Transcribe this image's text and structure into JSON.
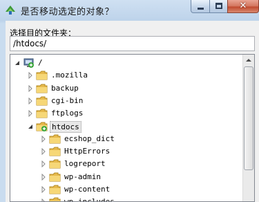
{
  "dialog": {
    "title": "是否移动选定的对象？",
    "close_glyph": "✕"
  },
  "destination": {
    "label": "选择目的文件夹：",
    "path_value": "/htdocs/"
  },
  "tree": {
    "items": [
      {
        "label": "/",
        "expanded": true
      },
      {
        "label": ".mozilla",
        "expanded": false
      },
      {
        "label": "backup",
        "expanded": false
      },
      {
        "label": "cgi-bin",
        "expanded": false
      },
      {
        "label": "ftplogs",
        "expanded": false
      },
      {
        "label": "htdocs",
        "expanded": true,
        "selected": true
      },
      {
        "label": "ecshop_dict",
        "expanded": false
      },
      {
        "label": "HttpErrors",
        "expanded": false
      },
      {
        "label": "logreport",
        "expanded": false
      },
      {
        "label": "wp-admin",
        "expanded": false
      },
      {
        "label": "wp-content",
        "expanded": false
      },
      {
        "label": "wp-includes",
        "expanded": false
      }
    ]
  },
  "icons": {
    "app": "recycle-arrow-icon",
    "root": "computer-icon",
    "folder": "folder-icon",
    "add_badge": "green-plus-badge-icon"
  },
  "colors": {
    "folder": "#e6b94c",
    "badge": "#3aa53a",
    "close": "#c14a2e"
  }
}
